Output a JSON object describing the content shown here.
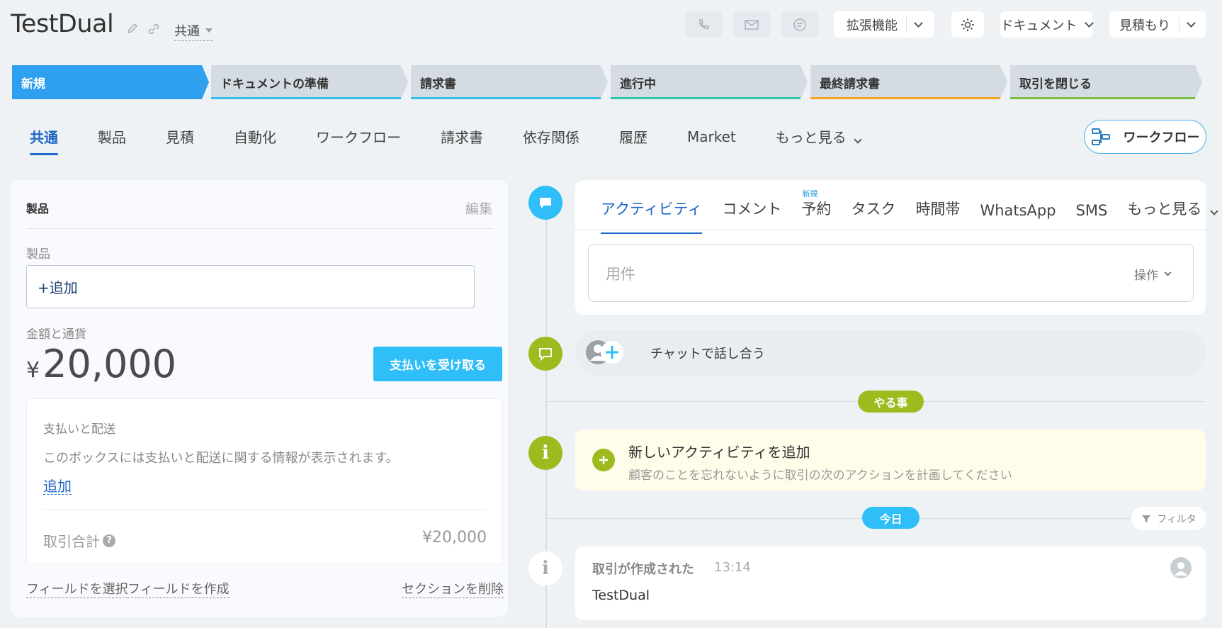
{
  "header": {
    "title": "TestDual",
    "category": "共通",
    "extensions_label": "拡張機能",
    "documents_label": "ドキュメント",
    "estimate_label": "見積もり"
  },
  "stages": [
    {
      "label": "新規",
      "color": "#2fa0f0",
      "active": true
    },
    {
      "label": "ドキュメントの準備",
      "color": "#36c0e8"
    },
    {
      "label": "請求書",
      "color": "#36c0e8"
    },
    {
      "label": "進行中",
      "color": "#2fc7a8"
    },
    {
      "label": "最終請求書",
      "color": "#f5a623"
    },
    {
      "label": "取引を閉じる",
      "color": "#7bc043"
    }
  ],
  "tabs": [
    "共通",
    "製品",
    "見積",
    "自動化",
    "ワークフロー",
    "請求書",
    "依存関係",
    "履歴",
    "Market",
    "もっと見る"
  ],
  "workflow_button": "ワークフロー",
  "left_panel": {
    "section_title": "製品",
    "edit_label": "編集",
    "product_label": "製品",
    "product_add": "+追加",
    "amount_label": "金額と通貨",
    "currency_symbol": "¥",
    "amount_value": "20,000",
    "pay_button": "支払いを受け取る",
    "payment_box": {
      "title": "支払いと配送",
      "description": "このボックスには支払いと配送に関する情報が表示されます。",
      "add_link": "追加",
      "total_label": "取引合計",
      "total_value": "¥20,000"
    },
    "footer": {
      "select_fields": "フィールドを選択",
      "create_field": "フィールドを作成",
      "delete_section": "セクションを削除"
    }
  },
  "activity": {
    "tabs": [
      "アクティビティ",
      "コメント",
      "予約",
      "タスク",
      "時間帯",
      "WhatsApp",
      "SMS",
      "もっと見る"
    ],
    "new_badge": "新規",
    "placeholder": "用件",
    "operation_label": "操作",
    "chat_label": "チャットで話し合う",
    "todo_pill": "やる事",
    "todo_title": "新しいアクティビティを追加",
    "todo_subtitle": "顧客のことを忘れないように取引の次のアクションを計画してください",
    "today_pill": "今日",
    "filter_label": "フィルタ",
    "history": {
      "title": "取引が作成された",
      "time": "13:14",
      "body": "TestDual"
    }
  },
  "colors": {
    "primary": "#2fa0f0",
    "pay_button": "#2fbef7",
    "timeline_blue": "#2fbef7",
    "timeline_green": "#9dbb1e",
    "link_blue": "#1e66c7"
  }
}
